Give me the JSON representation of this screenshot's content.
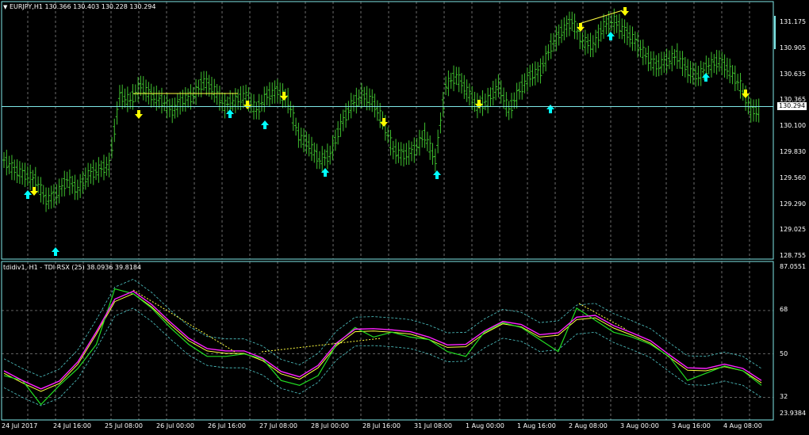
{
  "main_window": {
    "title": "EURJPY,H1",
    "ohlc": "130.366 130.403 130.228 130.294",
    "current_price": "130.294",
    "price_ticks": [
      "131.175",
      "130.905",
      "130.635",
      "130.365",
      "130.100",
      "129.830",
      "129.560",
      "129.290",
      "129.025",
      "128.755"
    ]
  },
  "indicator_window": {
    "title": "tdidiv1, H1 - TDI RSX (25) 38.0936 39.8184",
    "level_ticks": [
      "87.0551",
      "68",
      "50",
      "32",
      "23.9384"
    ]
  },
  "time_axis": [
    "24 Jul 2017",
    "24 Jul 16:00",
    "25 Jul 08:00",
    "26 Jul 00:00",
    "26 Jul 16:00",
    "27 Jul 08:00",
    "28 Jul 00:00",
    "28 Jul 16:00",
    "31 Jul 08:00",
    "1 Aug 00:00",
    "1 Aug 16:00",
    "2 Aug 08:00",
    "3 Aug 00:00",
    "3 Aug 16:00",
    "4 Aug 08:00"
  ],
  "colors": {
    "background": "#000000",
    "border": "#7fe8e8",
    "bars": "#3fbf2f",
    "grid": "#ffffff",
    "arrow_up": "#00ffff",
    "arrow_down": "#ffff00",
    "line_magenta": "#ff22ff",
    "line_green": "#22dd22",
    "line_yellow": "#ffff40",
    "band": "#50c8c8"
  },
  "chart_data": {
    "type": "line",
    "series": [
      {
        "values": [
          129.7,
          129.6,
          129.55,
          129.5,
          129.3,
          129.35,
          129.5,
          129.4,
          129.55,
          129.6,
          129.65,
          130.35,
          130.3,
          130.45,
          130.35,
          130.3,
          130.2,
          130.3,
          130.35,
          130.5,
          130.4,
          130.25,
          130.3,
          130.35,
          130.2,
          130.35,
          130.4,
          130.3,
          129.95,
          129.85,
          129.7,
          129.75,
          130.05,
          130.25,
          130.35,
          130.3,
          130.1,
          129.8,
          129.75,
          129.8,
          129.95,
          129.7,
          130.45,
          130.55,
          130.4,
          130.25,
          130.3,
          130.45,
          130.2,
          130.4,
          130.55,
          130.6,
          130.85,
          131.0,
          131.1,
          130.9,
          130.85,
          131.05,
          131.1,
          131.0,
          130.9,
          130.75,
          130.65,
          130.7,
          130.75,
          130.6,
          130.55,
          130.65,
          130.7,
          130.6,
          130.45,
          130.2
        ]
      },
      {
        "values": [
          42,
          40,
          30,
          38,
          45,
          55,
          78,
          76,
          70,
          62,
          55,
          50,
          50,
          51,
          49,
          40,
          38,
          42,
          55,
          62,
          58,
          60,
          58,
          57,
          52,
          50,
          60,
          64,
          62,
          57,
          52,
          70,
          65,
          60,
          58,
          55,
          50,
          40,
          43,
          46,
          44,
          38
        ]
      }
    ]
  }
}
